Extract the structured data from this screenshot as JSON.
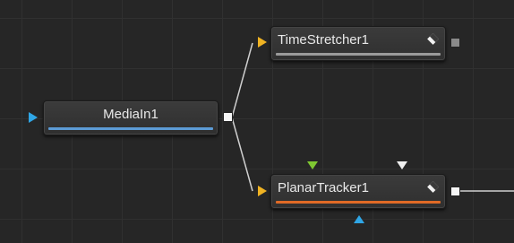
{
  "app": "Fusion Node Editor",
  "nodes": {
    "media_in": {
      "label": "MediaIn1",
      "color_bar": "#5c9bd6"
    },
    "time_stretcher": {
      "label": "TimeStretcher1",
      "color_bar": "#9a9a9a"
    },
    "planar_tracker": {
      "label": "PlanarTracker1",
      "color_bar": "#e06a26"
    }
  },
  "colors": {
    "background_input": "#f0b323",
    "foreground_input": "#7fc832",
    "effect_mask_input": "#2fa6e6",
    "media_in_input": "#2fa6e6",
    "output": "#f5f5f5",
    "wire": "#d0d0d0"
  },
  "icons": [
    "keyframe-icon",
    "output-port",
    "input-arrow"
  ]
}
